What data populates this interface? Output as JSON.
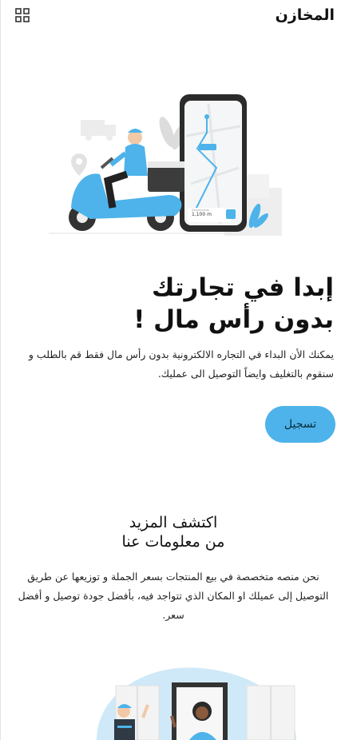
{
  "header": {
    "brand": "المخازن",
    "menu_icon": "grid-icon"
  },
  "hero": {
    "title_line1": "إبدا في تجارتك",
    "title_line2": "بدون رأس مال !",
    "description": "يمكنك الأن البداء في التجاره الالكترونية بدون رأس مال فقط قم بالطلب و سنقوم بالتغليف وايضاً التوصيل الى عمليك.",
    "cta_label": "تسجيل",
    "illustration": {
      "phone_distance": "1,100 m",
      "phone_caption": "Deliveryman"
    }
  },
  "about": {
    "title_line1": "اكتشف المزيد",
    "title_line2": "من معلومات عنا",
    "description": "نحن منصه متخصصة في بيع المنتجات بسعر الجملة و توزيعها عن طريق التوصيل إلى عميلك او المكان الذي تتواجد فيه، بأفضل جودة توصيل و أفضل سعر."
  },
  "colors": {
    "accent": "#4db3ea",
    "text": "#111111"
  }
}
